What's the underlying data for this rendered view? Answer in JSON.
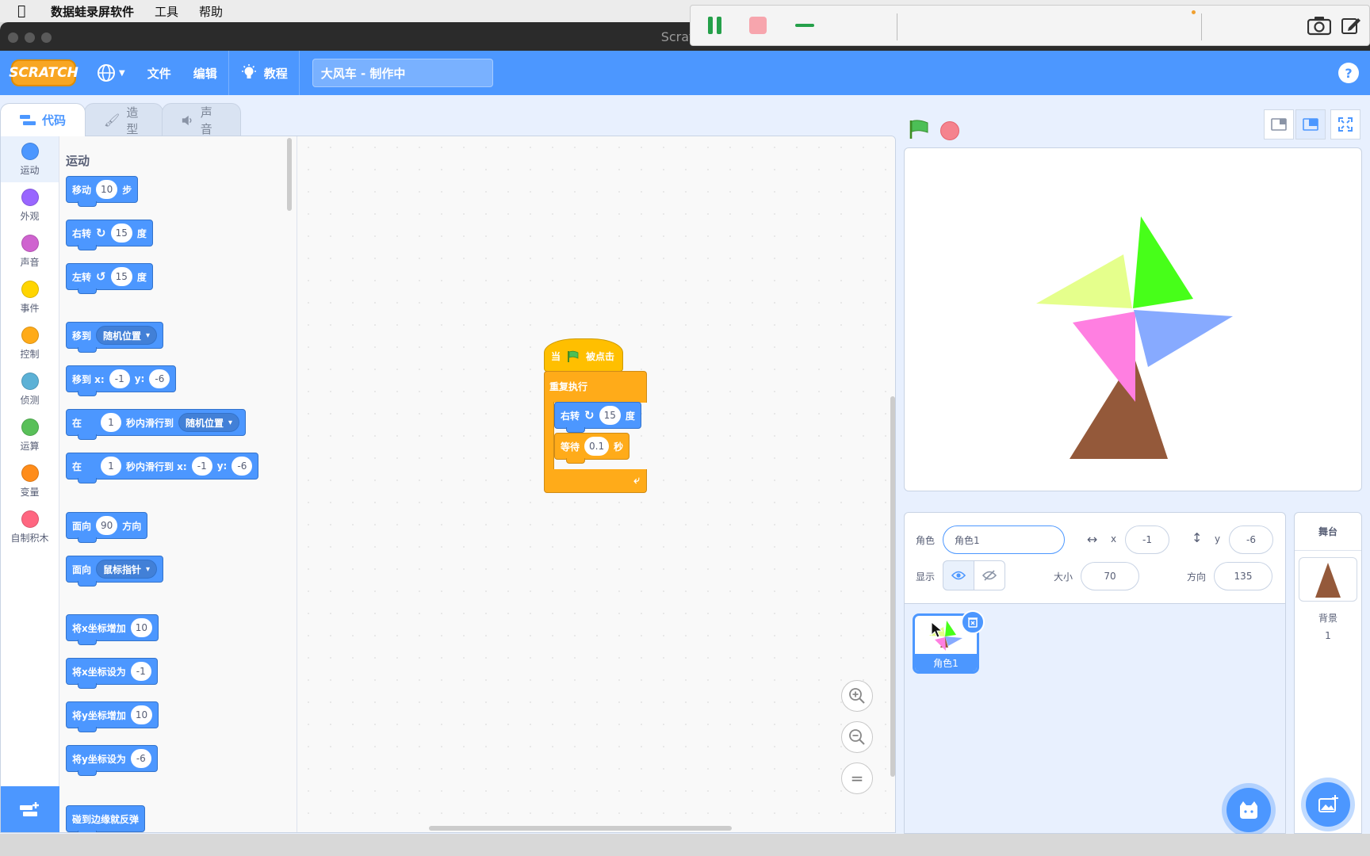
{
  "os_menubar": {
    "app_name": "数据蛙录屏软件",
    "menu_tools": "工具",
    "menu_help": "帮助"
  },
  "window": {
    "title": "Scratch"
  },
  "scratch_menu": {
    "logo": "SCRATCH",
    "file": "文件",
    "edit": "编辑",
    "tutorials": "教程",
    "project_title": "大风车 - 制作中",
    "help": "?"
  },
  "tabs": {
    "code": "代码",
    "costumes": "造型",
    "sounds": "声音"
  },
  "categories": [
    {
      "label": "运动",
      "color": "#4c97ff"
    },
    {
      "label": "外观",
      "color": "#9966ff"
    },
    {
      "label": "声音",
      "color": "#cf63cf"
    },
    {
      "label": "事件",
      "color": "#ffd500"
    },
    {
      "label": "控制",
      "color": "#ffab19"
    },
    {
      "label": "侦测",
      "color": "#5cb1d6"
    },
    {
      "label": "运算",
      "color": "#59c059"
    },
    {
      "label": "变量",
      "color": "#ff8c1a"
    },
    {
      "label": "自制积木",
      "color": "#ff6680"
    }
  ],
  "palette": {
    "heading": "运动",
    "move": {
      "a": "移动",
      "v": "10",
      "b": "步"
    },
    "turn_right": {
      "a": "右转",
      "v": "15",
      "b": "度"
    },
    "turn_left": {
      "a": "左转",
      "v": "15",
      "b": "度"
    },
    "goto": {
      "a": "移到",
      "menu": "随机位置"
    },
    "goto_xy": {
      "a": "移到 x:",
      "x": "-1",
      "b": "y:",
      "y": "-6"
    },
    "glide": {
      "a": "在",
      "v": "1",
      "b": "秒内滑行到",
      "menu": "随机位置"
    },
    "glide_xy": {
      "a": "在",
      "v": "1",
      "b": "秒内滑行到 x:",
      "x": "-1",
      "c": "y:",
      "y": "-6"
    },
    "point_dir": {
      "a": "面向",
      "v": "90",
      "b": "方向"
    },
    "point_towards": {
      "a": "面向",
      "menu": "鼠标指针"
    },
    "change_x": {
      "a": "将x坐标增加",
      "v": "10"
    },
    "set_x": {
      "a": "将x坐标设为",
      "v": "-1"
    },
    "change_y": {
      "a": "将y坐标增加",
      "v": "10"
    },
    "set_y": {
      "a": "将y坐标设为",
      "v": "-6"
    },
    "bounce": {
      "a": "碰到边缘就反弹"
    }
  },
  "script": {
    "hat": {
      "a": "当",
      "b": "被点击"
    },
    "forever": "重复执行",
    "turn": {
      "a": "右转",
      "v": "15",
      "b": "度"
    },
    "wait": {
      "a": "等待",
      "v": "0.1",
      "b": "秒"
    }
  },
  "sprite_info": {
    "sprite_label": "角色",
    "sprite_name": "角色1",
    "x_label": "x",
    "x_value": "-1",
    "y_label": "y",
    "y_value": "-6",
    "show_label": "显示",
    "size_label": "大小",
    "size_value": "70",
    "direction_label": "方向",
    "direction_value": "135"
  },
  "sprite_list": [
    {
      "name": "角色1"
    }
  ],
  "stage_pane": {
    "title": "舞台",
    "backdrops_label": "背景",
    "backdrops_count": "1"
  },
  "colors": {
    "accent": "#4c97ff",
    "motion": "#4c97ff",
    "events": "#ffbf00",
    "control": "#ffab19"
  }
}
